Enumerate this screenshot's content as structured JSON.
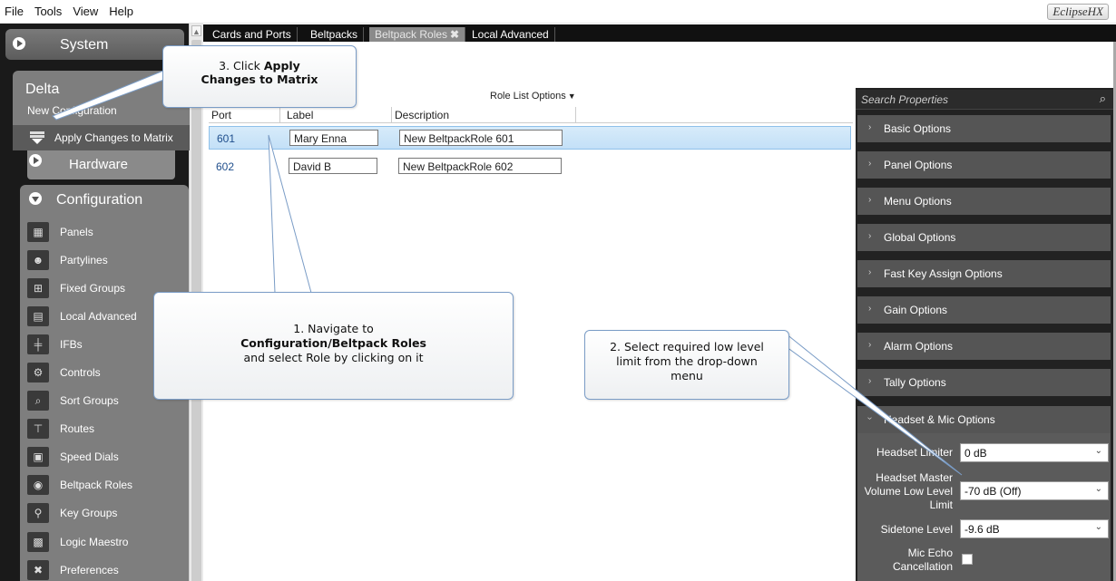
{
  "menubar": {
    "items": [
      "File",
      "Tools",
      "View",
      "Help"
    ],
    "brand": "EclipseHX"
  },
  "sidebar": {
    "system_label": "System",
    "delta_title": "Delta",
    "delta_subtitle": "New Configuration",
    "apply_label": "Apply Changes to Matrix",
    "hardware_label": "Hardware",
    "configuration_label": "Configuration",
    "config_items": [
      {
        "label": "Panels",
        "icon": "panels-icon"
      },
      {
        "label": "Partylines",
        "icon": "partylines-icon"
      },
      {
        "label": "Fixed Groups",
        "icon": "fixed-groups-icon"
      },
      {
        "label": "Local Advanced",
        "icon": "local-advanced-icon"
      },
      {
        "label": "IFBs",
        "icon": "ifbs-icon"
      },
      {
        "label": "Controls",
        "icon": "controls-icon"
      },
      {
        "label": "Sort Groups",
        "icon": "sort-groups-icon"
      },
      {
        "label": "Routes",
        "icon": "routes-icon"
      },
      {
        "label": "Speed Dials",
        "icon": "speed-dials-icon"
      },
      {
        "label": "Beltpack Roles",
        "icon": "beltpack-roles-icon"
      },
      {
        "label": "Key Groups",
        "icon": "key-groups-icon"
      },
      {
        "label": "Logic Maestro",
        "icon": "logic-maestro-icon"
      },
      {
        "label": "Preferences",
        "icon": "preferences-icon"
      }
    ]
  },
  "tabs": [
    {
      "label": "Cards and Ports",
      "active": false
    },
    {
      "label": "Beltpacks",
      "active": false
    },
    {
      "label": "Beltpack Roles",
      "active": true,
      "close": "✖"
    },
    {
      "label": "Local Advanced",
      "active": false
    }
  ],
  "grid": {
    "options_label": "Role List Options",
    "columns": {
      "port": "Port",
      "label": "Label",
      "description": "Description"
    },
    "rows": [
      {
        "port": "601",
        "label": "Mary Enna",
        "description": "New BeltpackRole 601",
        "selected": true
      },
      {
        "port": "602",
        "label": "David B",
        "description": "New BeltpackRole 602",
        "selected": false
      }
    ]
  },
  "properties": {
    "search_placeholder": "Search Properties",
    "sections": [
      "Basic Options",
      "Panel Options",
      "Menu Options",
      "Global Options",
      "Fast Key Assign Options",
      "Gain Options",
      "Alarm Options",
      "Tally Options",
      "Headset & Mic Options"
    ],
    "headset": {
      "limiter_label": "Headset Limiter",
      "limiter_value": "0 dB",
      "master_label": "Headset Master Volume Low Level Limit",
      "master_value": "-70 dB (Off)",
      "sidetone_label": "Sidetone Level",
      "sidetone_value": "-9.6 dB",
      "echo_label": "Mic Echo Cancellation",
      "echo_checked": false
    }
  },
  "callouts": {
    "step3_line1": "3. Click ",
    "step3_bold1": "Apply",
    "step3_bold2": "Changes to Matrix",
    "step1_line1": "1. Navigate to",
    "step1_bold": "Configuration/Beltpack Roles",
    "step1_line3": "and select Role by clicking on it",
    "step2_line1": "2. Select required low level",
    "step2_line2": "limit from the drop-down",
    "step2_line3": "menu"
  },
  "colors": {
    "accent_selected_row": "#c3e0f7",
    "port_text": "#1f4e8c",
    "callout_border": "#7a9cc6"
  }
}
